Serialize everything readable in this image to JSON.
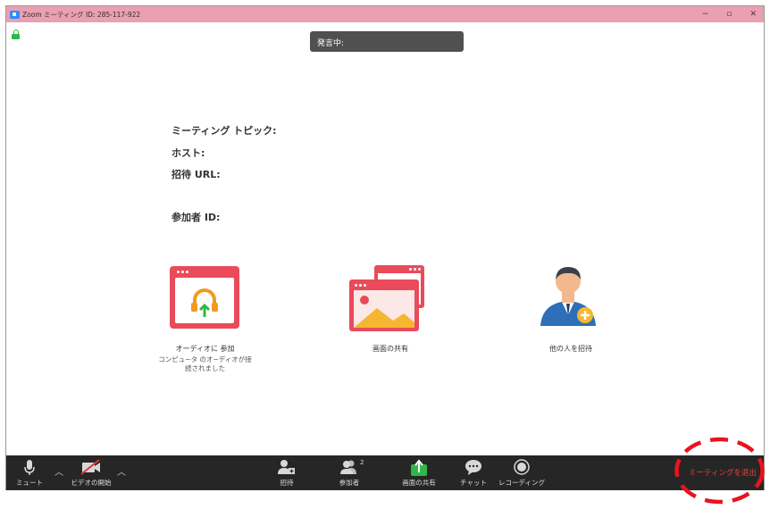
{
  "window": {
    "title": "Zoom ミーティング ID: 285-117-922",
    "minimize": "−",
    "restore": "▫",
    "close": "✕"
  },
  "speaking_label": "発言中:",
  "meeting_info": {
    "topic_label": "ミーティング トピック:",
    "host_label": "ホスト:",
    "invite_url_label": "招待 URL:",
    "participant_id_label": "参加者 ID:"
  },
  "actions": {
    "audio": {
      "label": "オーディオに 参加",
      "sublabel_line1": "コンピュ−タ のオ−ディオが接",
      "sublabel_line2": "続されました"
    },
    "share": {
      "label": "画面の共有"
    },
    "invite": {
      "label": "他の人を招待"
    }
  },
  "toolbar": {
    "mute_label": "ミュート",
    "video_label": "ビデオの開始",
    "invite_label": "招待",
    "participants_label": "参加者",
    "participants_count": "2",
    "share_label": "画面の共有",
    "chat_label": "チャット",
    "record_label": "レコーディング",
    "leave_label": "ミーティングを退出"
  },
  "colors": {
    "titlebar": "#e8a0b2",
    "accent_red": "#e94b5b",
    "share_green": "#2fb84a",
    "leave_red": "#e8403a",
    "toolbar_bg": "#262626"
  }
}
